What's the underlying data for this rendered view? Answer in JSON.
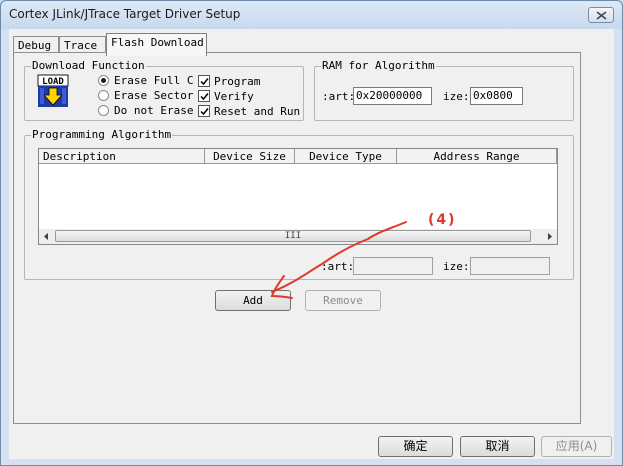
{
  "window": {
    "title": "Cortex JLink/JTrace Target Driver Setup",
    "close_icon": "close-icon"
  },
  "tabs": [
    {
      "label": "Debug",
      "active": false
    },
    {
      "label": "Trace",
      "active": false
    },
    {
      "label": "Flash Download",
      "active": true
    }
  ],
  "download_function": {
    "title": "Download Function",
    "logo_text": "LOAD",
    "radios": [
      {
        "label": "Erase Full C",
        "checked": true
      },
      {
        "label": "Erase Sector",
        "checked": false
      },
      {
        "label": "Do not Erase",
        "checked": false
      }
    ],
    "checks": [
      {
        "label": "Program",
        "checked": true
      },
      {
        "label": "Verify",
        "checked": true
      },
      {
        "label": "Reset and Run",
        "checked": true
      }
    ]
  },
  "ram": {
    "title": "RAM for Algorithm",
    "start_label": ":art:",
    "start_value": "0x20000000",
    "size_label": "ize:",
    "size_value": "0x0800"
  },
  "programming": {
    "title": "Programming Algorithm",
    "columns": [
      "Description",
      "Device Size",
      "Device Type",
      "Address Range"
    ],
    "rows": [],
    "scroll_thumb_glyph": "III",
    "start_label": ":art:",
    "start_value": "",
    "size_label": "ize:",
    "size_value": ""
  },
  "buttons": {
    "add": "Add",
    "remove": "Remove",
    "ok": "确定",
    "cancel": "取消",
    "apply": "应用(A)"
  },
  "annotation": {
    "label": "(4)",
    "color": "#e2372b"
  }
}
